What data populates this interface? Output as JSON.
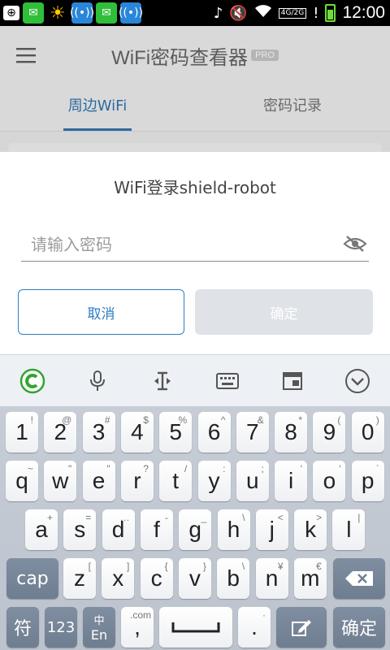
{
  "status_bar": {
    "time": "12:00",
    "network_label": "4G/2G",
    "icons": [
      "add-icon",
      "wechat-icon",
      "sun-icon",
      "wifi-tool-icon",
      "wechat-icon",
      "wifi-tool-icon",
      "music-off-icon",
      "mute-icon",
      "wifi-icon",
      "signal-icon",
      "alert-icon",
      "battery-icon"
    ]
  },
  "app": {
    "title": "WiFi密码查看器",
    "badge": "PRO",
    "tabs": [
      {
        "label": "周边WiFi",
        "active": true
      },
      {
        "label": "密码记录",
        "active": false
      }
    ]
  },
  "dialog": {
    "title": "WiFi登录shield-robot",
    "password_placeholder": "请输入密码",
    "password_value": "",
    "cancel_label": "取消",
    "confirm_label": "确定"
  },
  "keyboard": {
    "toolbar_icons": [
      "cootek-logo-icon",
      "microphone-icon",
      "cursor-icon",
      "keyboard-icon",
      "window-icon",
      "collapse-icon"
    ],
    "row1": [
      {
        "k": "1",
        "s": "!"
      },
      {
        "k": "2",
        "s": "@"
      },
      {
        "k": "3",
        "s": "#"
      },
      {
        "k": "4",
        "s": "$"
      },
      {
        "k": "5",
        "s": "%"
      },
      {
        "k": "6",
        "s": "^"
      },
      {
        "k": "7",
        "s": "&"
      },
      {
        "k": "8",
        "s": "*"
      },
      {
        "k": "9",
        "s": "("
      },
      {
        "k": "0",
        "s": ")"
      }
    ],
    "row2": [
      {
        "k": "q",
        "s": "~"
      },
      {
        "k": "w",
        "s": "\""
      },
      {
        "k": "e",
        "s": "\""
      },
      {
        "k": "r",
        "s": "?"
      },
      {
        "k": "t",
        "s": "/"
      },
      {
        "k": "y",
        "s": ":"
      },
      {
        "k": "u",
        "s": ";"
      },
      {
        "k": "i",
        "s": "'"
      },
      {
        "k": "o",
        "s": "'"
      },
      {
        "k": "p",
        "s": "`"
      }
    ],
    "row3": [
      {
        "k": "a",
        "s": "+"
      },
      {
        "k": "s",
        "s": "="
      },
      {
        "k": "d",
        "s": "…"
      },
      {
        "k": "f",
        "s": "-"
      },
      {
        "k": "g",
        "s": "_"
      },
      {
        "k": "h",
        "s": "\\"
      },
      {
        "k": "j",
        "s": "<"
      },
      {
        "k": "k",
        "s": ">"
      },
      {
        "k": "l",
        "s": "|"
      }
    ],
    "row4": [
      {
        "k": "z",
        "s": "["
      },
      {
        "k": "x",
        "s": "]"
      },
      {
        "k": "c",
        "s": "{"
      },
      {
        "k": "v",
        "s": "}"
      },
      {
        "k": "b",
        "s": "\\"
      },
      {
        "k": "n",
        "s": "¥"
      },
      {
        "k": "m",
        "s": "€"
      }
    ],
    "cap_label": "cap",
    "symbol_label": "符",
    "num_label": "123",
    "lang_top": "中",
    "lang_bottom": "En",
    "comma_top": ".com",
    "comma_main": ",",
    "period_main": ".",
    "period_top": "·",
    "enter_label": "确定"
  }
}
